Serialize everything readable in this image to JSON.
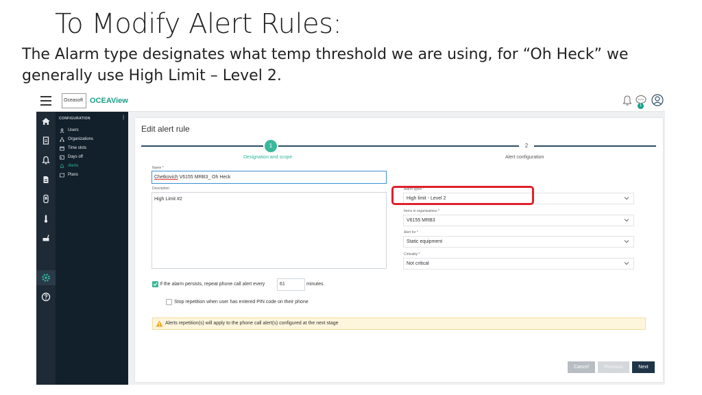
{
  "slide": {
    "title": "To Modify Alert Rules:",
    "subtitle": "The Alarm type designates what temp threshold we are using, for “Oh Heck” we generally use High Limit – Level 2."
  },
  "app": {
    "logo_box": "Oceasoft",
    "logo_text": "OCEAView",
    "notification_count": "1"
  },
  "sidebar": {
    "heading": "CONFIGURATION",
    "items": [
      {
        "label": "Users",
        "icon": "user-icon",
        "active": false
      },
      {
        "label": "Organizations",
        "icon": "org-icon",
        "active": false
      },
      {
        "label": "Time slots",
        "icon": "timeslot-icon",
        "active": false
      },
      {
        "label": "Days off",
        "icon": "calendar-icon",
        "active": false
      },
      {
        "label": "Alerts",
        "icon": "bell-icon",
        "active": true
      },
      {
        "label": "Plans",
        "icon": "map-icon",
        "active": false
      }
    ]
  },
  "form": {
    "title": "Edit alert rule",
    "steps": [
      {
        "number": "1",
        "label": "Designation and scope",
        "active": true
      },
      {
        "number": "2",
        "label": "Alert configuration",
        "active": false
      }
    ],
    "name_label": "Name *",
    "name_value_a": "Chetkovich",
    "name_value_b": " V6155 MRB3_ Oh Heck",
    "description_label": "Description",
    "description_value": "High Limit #2",
    "alarm_types_label": "Alarm types *",
    "alarm_types_value": "High limit - Level 2",
    "items_label": "Items in organizations *",
    "items_value": "V6155 MRB3",
    "alert_for_label": "Alert for *",
    "alert_for_value": "Static equipment",
    "criticality_label": "Criticality *",
    "criticality_value": "Not critical",
    "repeat_prefix": "If the alarm persists, repeat phone call alert every",
    "repeat_value": "61",
    "repeat_suffix": "minutes.",
    "repeat_checked": true,
    "stop_label": "Stop repetition when user has entered PIN code on their phone",
    "stop_checked": false,
    "warning_text": "Alerts repetition(s) will apply to the phone call alert(s) configured at the next stage",
    "btn_cancel": "Cancel",
    "btn_previous": "Previous",
    "btn_next": "Next"
  },
  "colors": {
    "accent": "#1aa089",
    "sidebar_bg": "#12202b",
    "highlight": "#e0202a",
    "next_button": "#1f3447"
  }
}
